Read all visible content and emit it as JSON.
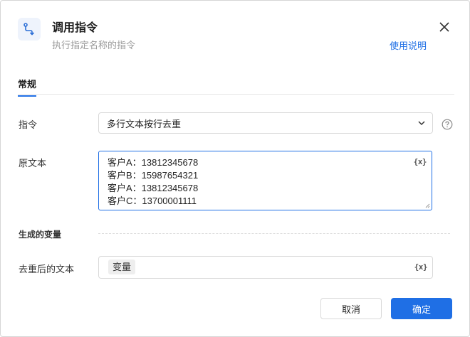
{
  "header": {
    "title": "调用指令",
    "subtitle": "执行指定名称的指令",
    "help_link": "使用说明",
    "icon": "route-icon",
    "close_icon": "close-icon"
  },
  "tabs": [
    {
      "label": "常规",
      "active": true
    }
  ],
  "form": {
    "command_label": "指令",
    "command_value": "多行文本按行去重",
    "source_label": "原文本",
    "source_lines": [
      "客户A：13812345678",
      "客户B：15987654321",
      "客户A：13812345678",
      "客户C：13700001111"
    ],
    "var_button": "{x}"
  },
  "output": {
    "section_title": "生成的变量",
    "label": "去重后的文本",
    "variable_tag": "变量",
    "var_button": "{x}"
  },
  "footer": {
    "cancel": "取消",
    "ok": "确定"
  },
  "colors": {
    "accent": "#1f6fe5",
    "muted_text": "#9a9a9a",
    "border": "#d9d9d9"
  }
}
